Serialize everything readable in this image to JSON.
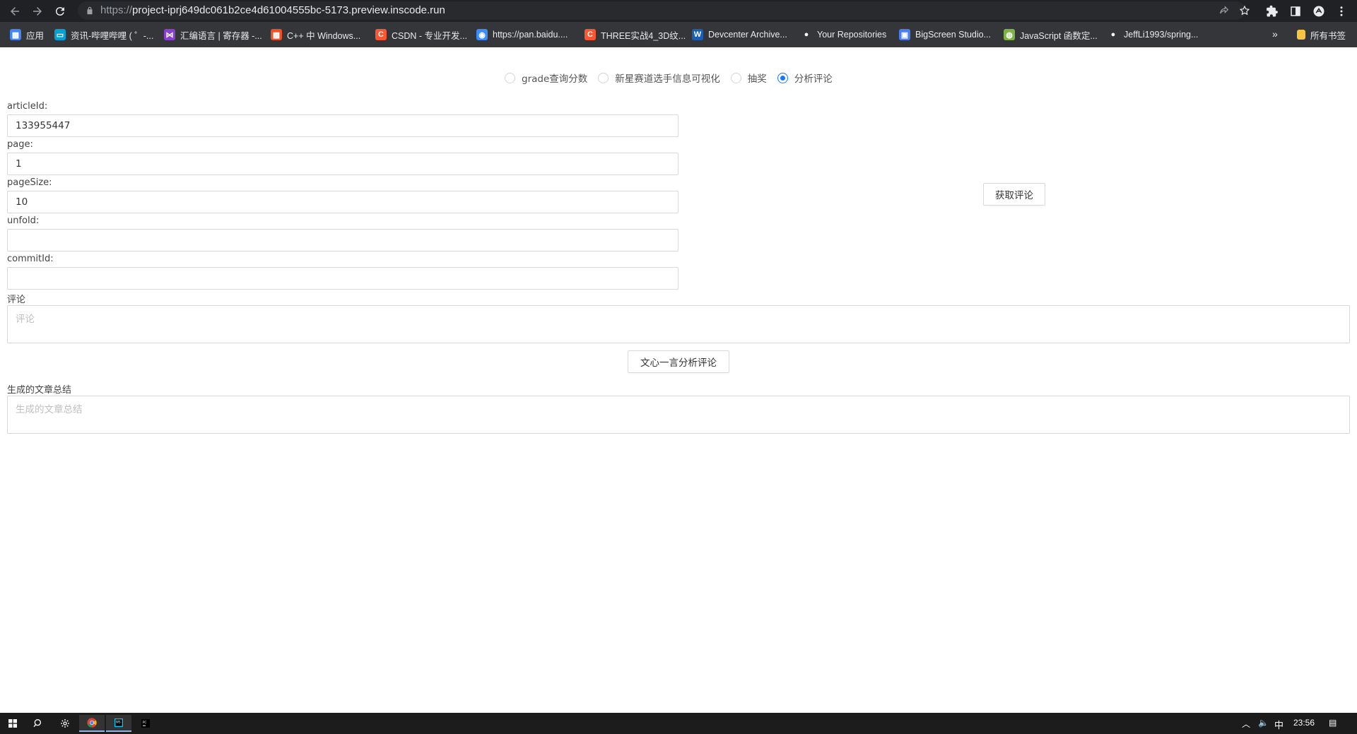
{
  "browser": {
    "url_scheme": "https://",
    "url_rest": "project-iprj649dc061b2ce4d61004555bc-5173.preview.inscode.run",
    "bookmarks": [
      {
        "label": "应用",
        "color": "#4285f4",
        "glyph": "▦"
      },
      {
        "label": "资讯-哔哩哔哩 ( ゜-...",
        "color": "#00a1d6",
        "glyph": "▭"
      },
      {
        "label": "汇编语言 | 寄存器 -...",
        "color": "#8b3fd1",
        "glyph": "⋈"
      },
      {
        "label": "C++ 中 Windows...",
        "color": "#f25022",
        "glyph": "▦"
      },
      {
        "label": "CSDN - 专业开发...",
        "color": "#fc5531",
        "glyph": "C"
      },
      {
        "label": "https://pan.baidu....",
        "color": "#3b8cff",
        "glyph": "◉"
      },
      {
        "label": "THREE实战4_3D纹...",
        "color": "#fc5531",
        "glyph": "C"
      },
      {
        "label": "Devcenter Archive...",
        "color": "#1a5fb4",
        "glyph": "W"
      },
      {
        "label": "Your Repositories",
        "color": "#ffffff",
        "glyph": "●"
      },
      {
        "label": "BigScreen Studio...",
        "color": "#4a7cf7",
        "glyph": "▣"
      },
      {
        "label": "JavaScript 函数定...",
        "color": "#7cb342",
        "glyph": "◍"
      },
      {
        "label": "JeffLi1993/spring...",
        "color": "#ffffff",
        "glyph": "●"
      }
    ],
    "more": "»",
    "all_bookmarks": "所有书签"
  },
  "radios": [
    {
      "label": "grade查询分数",
      "checked": false
    },
    {
      "label": "新星赛道选手信息可视化",
      "checked": false
    },
    {
      "label": "抽奖",
      "checked": false
    },
    {
      "label": "分析评论",
      "checked": true
    }
  ],
  "form": {
    "articleId_label": "articleId:",
    "articleId_value": "133955447",
    "page_label": "page:",
    "page_value": "1",
    "pageSize_label": "pageSize:",
    "pageSize_value": "10",
    "unfold_label": "unfold:",
    "unfold_value": "",
    "commitId_label": "commitId:",
    "commitId_value": "",
    "get_comments_button": "获取评论",
    "comment_label": "评论",
    "comment_placeholder": "评论",
    "analyze_button": "文心一言分析评论",
    "summary_label": "生成的文章总结",
    "summary_placeholder": "生成的文章总结"
  },
  "taskbar": {
    "ime": "中",
    "time": "23:56"
  }
}
